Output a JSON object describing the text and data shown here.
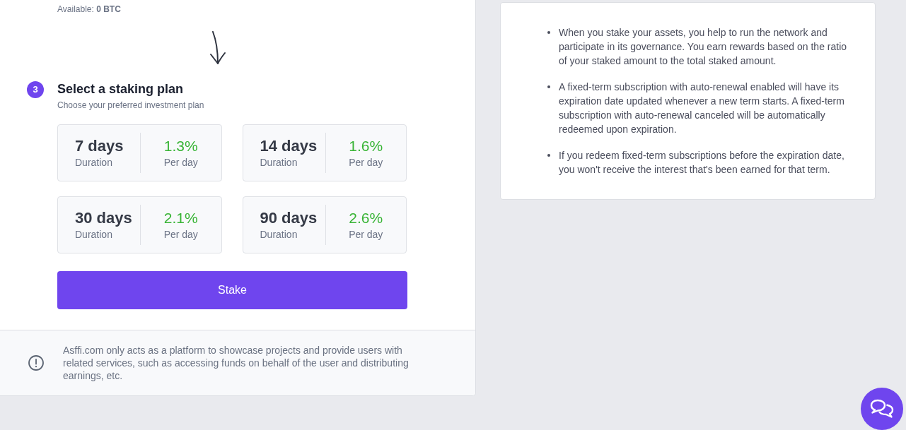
{
  "balance": {
    "text": "Available: **0 BTC**"
  },
  "step": {
    "number": "3",
    "title": "Select a staking plan",
    "subtitle": "Choose your preferred investment plan"
  },
  "plans": [
    {
      "duration": "7 days",
      "duration_label": "Duration",
      "rate": "1.3%",
      "rate_label": "Per day",
      "selected": false
    },
    {
      "duration": "14 days",
      "duration_label": "Duration",
      "rate": "1.6%",
      "rate_label": "Per day",
      "selected": false
    },
    {
      "duration": "30 days",
      "duration_label": "Duration",
      "rate": "2.1%",
      "rate_label": "Per day",
      "selected": false
    },
    {
      "duration": "90 days",
      "duration_label": "Duration",
      "rate": "2.6%",
      "rate_label": "Per day",
      "selected": false
    }
  ],
  "stake_button": {
    "label": "Stake"
  },
  "notice": {
    "text": "Asffi.com only acts as a platform to showcase projects and provide users with related services, such as accessing funds on behalf of the user and distributing earnings, etc."
  },
  "info_card": {
    "bullets": [
      "When you stake your assets, you help to run the network and participate in its governance. You earn rewards based on the ratio of your staked amount to the total staked amount.",
      "A fixed-term subscription with auto-renewal enabled will have its expiration date updated whenever a new term starts. A fixed-term subscription with auto-renewal canceled will be automatically redeemed upon expiration.",
      "If you redeem fixed-term subscriptions before the expiration date, you won't receive the interest that's been earned for that term."
    ]
  }
}
